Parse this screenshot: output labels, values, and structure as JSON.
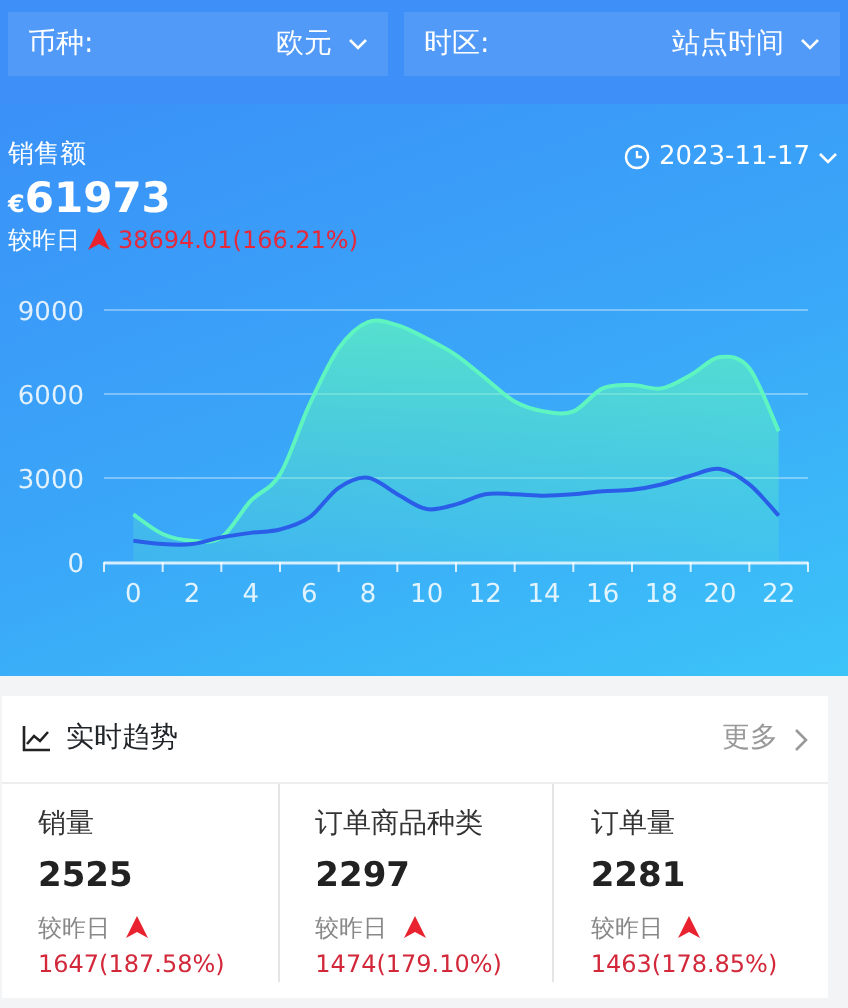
{
  "filters": [
    {
      "label": "币种:",
      "value": "欧元"
    },
    {
      "label": "时区:",
      "value": "站点时间"
    }
  ],
  "summary": {
    "title": "销售额",
    "currency": "€",
    "value": "61973",
    "date": "2023-11-17",
    "compare_label": "较昨日",
    "change": "38694.01(166.21%)",
    "chart_data": {
      "type": "area",
      "x": [
        0,
        1,
        2,
        3,
        4,
        5,
        6,
        7,
        8,
        9,
        10,
        11,
        12,
        13,
        14,
        15,
        16,
        17,
        18,
        19,
        20,
        21,
        22
      ],
      "xlim": [
        -1,
        23
      ],
      "xticks": [
        0,
        2,
        4,
        6,
        8,
        10,
        12,
        14,
        16,
        18,
        20,
        22
      ],
      "ylim": [
        0,
        9000
      ],
      "yticks": [
        0,
        3000,
        6000,
        9000
      ],
      "series": [
        {
          "type": "area",
          "color": "#5ef5c0",
          "values": [
            1700,
            1000,
            760,
            880,
            2180,
            3130,
            5610,
            7630,
            8570,
            8460,
            7980,
            7390,
            6560,
            5730,
            5380,
            5380,
            6200,
            6320,
            6200,
            6680,
            7320,
            6920,
            4670
          ]
        },
        {
          "type": "line",
          "color": "#2a5ee8",
          "values": [
            760,
            640,
            640,
            880,
            1040,
            1160,
            1590,
            2650,
            3010,
            2420,
            1890,
            2060,
            2420,
            2420,
            2370,
            2420,
            2530,
            2580,
            2770,
            3080,
            3320,
            2770,
            1660
          ]
        }
      ]
    }
  },
  "trend": {
    "title": "实时趋势",
    "more": "更多",
    "stats": [
      {
        "label": "销量",
        "value": "2525",
        "compare_label": "较昨日",
        "change": "1647(187.58%)"
      },
      {
        "label": "订单商品种类",
        "value": "2297",
        "compare_label": "较昨日",
        "change": "1474(179.10%)"
      },
      {
        "label": "订单量",
        "value": "2281",
        "compare_label": "较昨日",
        "change": "1463(178.85%)"
      }
    ]
  }
}
